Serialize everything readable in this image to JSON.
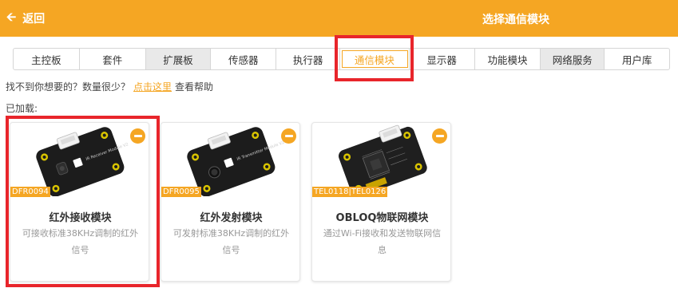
{
  "header": {
    "back_label": "返回",
    "title": "选择通信模块",
    "color": "#F5A623"
  },
  "tabs": [
    {
      "label": "主控板",
      "state": "normal"
    },
    {
      "label": "套件",
      "state": "normal"
    },
    {
      "label": "扩展板",
      "state": "grey"
    },
    {
      "label": "传感器",
      "state": "normal"
    },
    {
      "label": "执行器",
      "state": "normal"
    },
    {
      "label": "通信模块",
      "state": "active"
    },
    {
      "label": "显示器",
      "state": "normal"
    },
    {
      "label": "功能模块",
      "state": "normal"
    },
    {
      "label": "网络服务",
      "state": "grey"
    },
    {
      "label": "用户库",
      "state": "normal"
    }
  ],
  "help": {
    "prefix": "找不到你想要的？数量很少？",
    "link": "点击这里",
    "suffix": "查看帮助"
  },
  "loaded_label": "已加载:",
  "cards": [
    {
      "sku": "DFR0094",
      "title": "红外接收模块",
      "desc": "可接收标准38KHz调制的红外信号",
      "board_text": "IR Receiver Module V2",
      "icon": "ir-receiver-board-image"
    },
    {
      "sku": "DFR0095",
      "title": "红外发射模块",
      "desc": "可发射标准38KHz调制的红外信号",
      "board_text": "IR Transmitter Module V2",
      "icon": "ir-transmitter-board-image"
    },
    {
      "sku": "TEL0118|TEL0126",
      "title": "OBLOQ物联网模块",
      "desc": "通过Wi-Fi接收和发送物联网信息",
      "board_text": "",
      "icon": "obloq-board-image"
    }
  ],
  "colors": {
    "accent": "#F5A623",
    "highlight_box": "#E8252B"
  }
}
